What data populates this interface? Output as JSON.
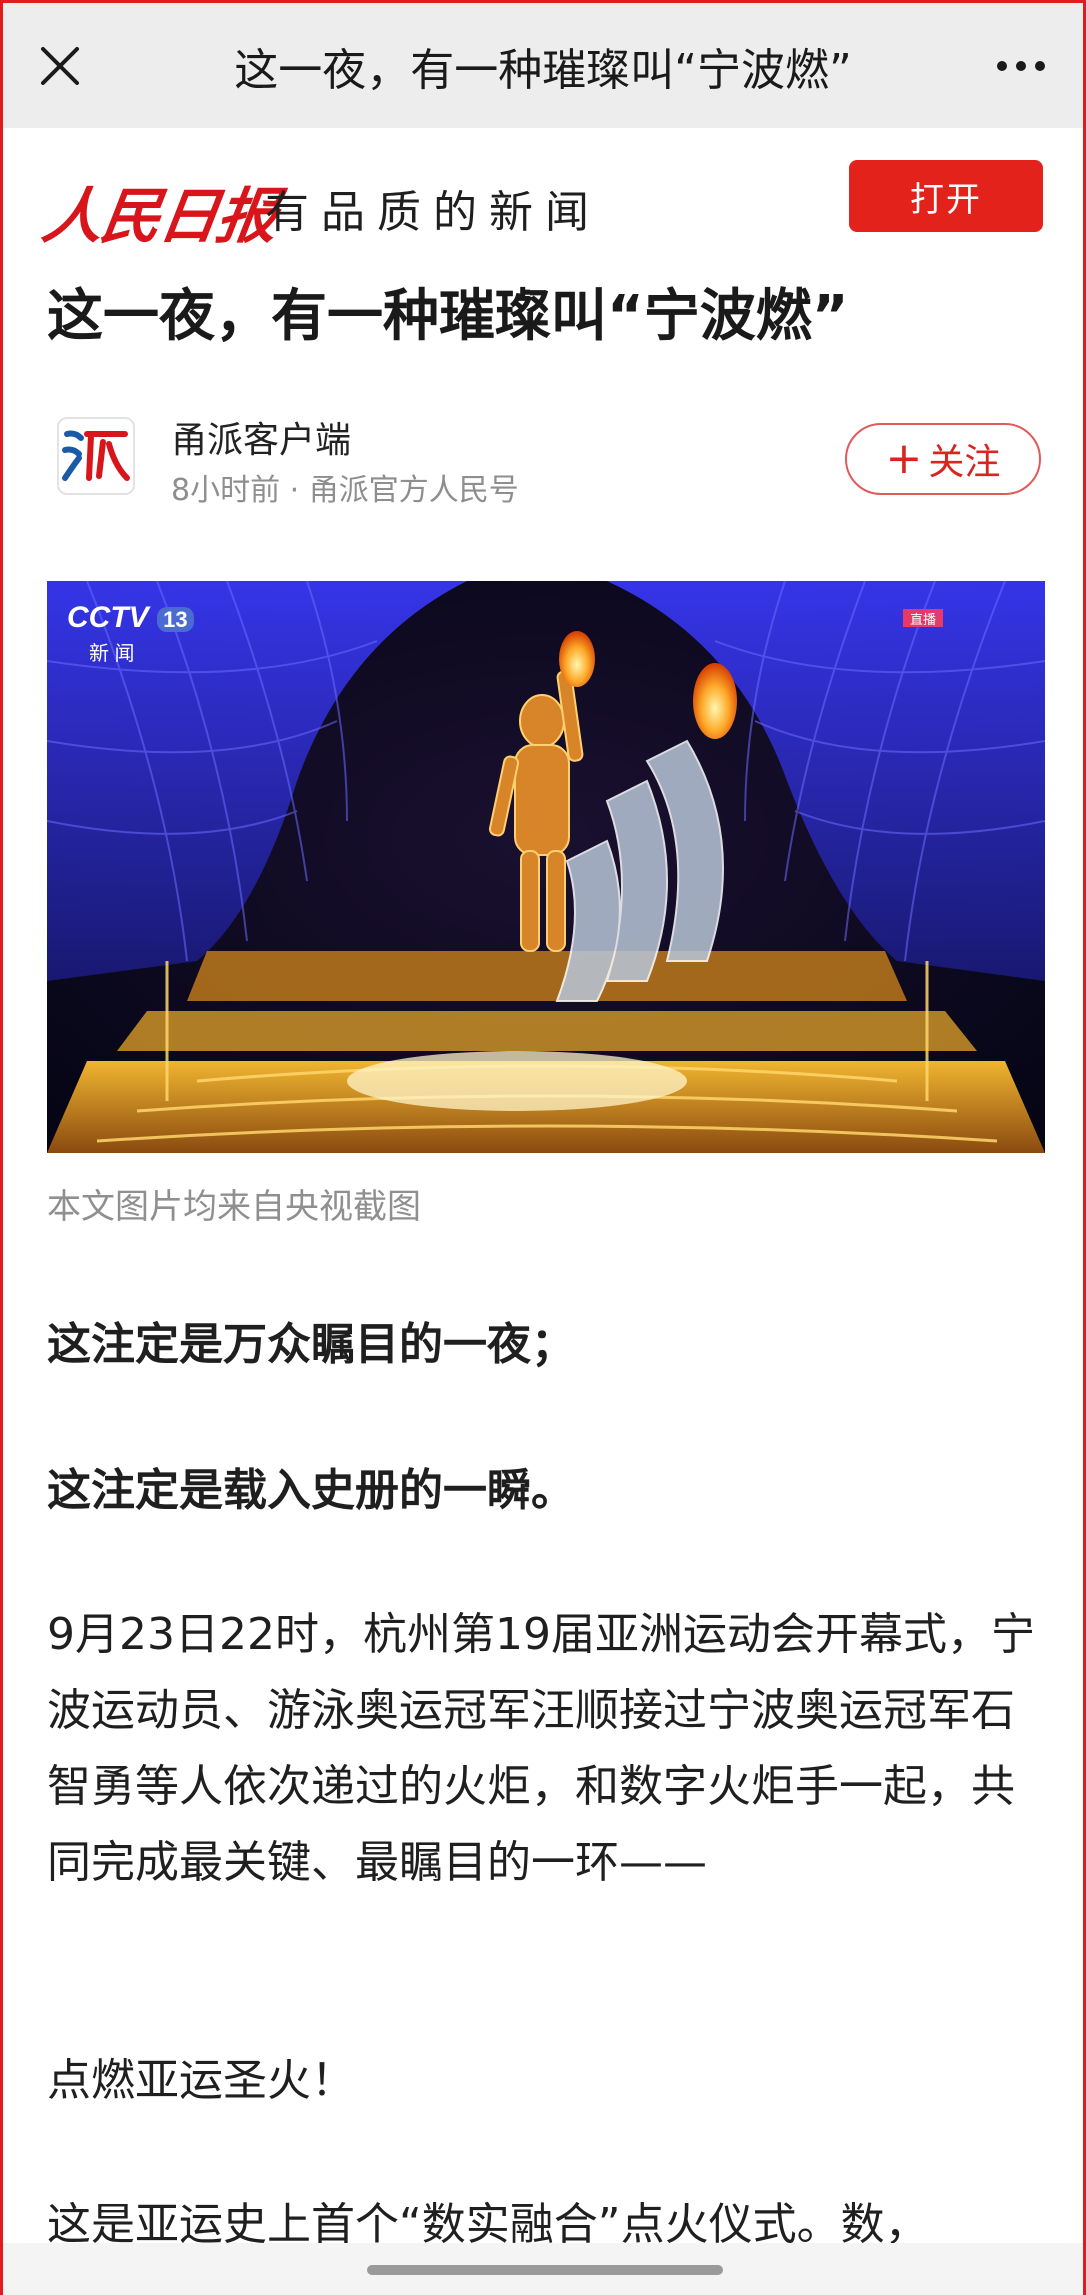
{
  "topbar": {
    "title": "这一夜，有一种璀璨叫“宁波燃”",
    "close_icon": "close-icon",
    "more_icon": "more-icon"
  },
  "brand": {
    "logo_text": "人民日报",
    "slogan": "有品质的新闻",
    "open_label": "打开",
    "accent": "#e3221c"
  },
  "article": {
    "title": "这一夜，有一种璀璨叫“宁波燃”",
    "author_name": "甬派客户端",
    "author_meta": "8小时前 · 甬派官方人民号",
    "avatar_text": "派",
    "follow_label": "关注",
    "follow_plus": "+",
    "image_caption": "本文图片均来自央视截图",
    "image_overlay": {
      "channel_logo": "CCTV",
      "channel_number": "13",
      "channel_sub": "新 闻",
      "live_badge": "直播"
    },
    "paragraphs": [
      "这注定是万众瞩目的一夜；",
      "这注定是载入史册的一瞬。",
      "9月23日22时，杭州第19届亚洲运动会开幕式，宁波运动员、游泳奥运冠军汪顺接过宁波奥运冠军石智勇等人依次递过的火炬，和数字火炬手一起，共同完成最关键、最瞩目的一环——",
      "点燃亚运圣火！",
      "这是亚运史上首个“数实融合”点火仪式。数，"
    ]
  }
}
